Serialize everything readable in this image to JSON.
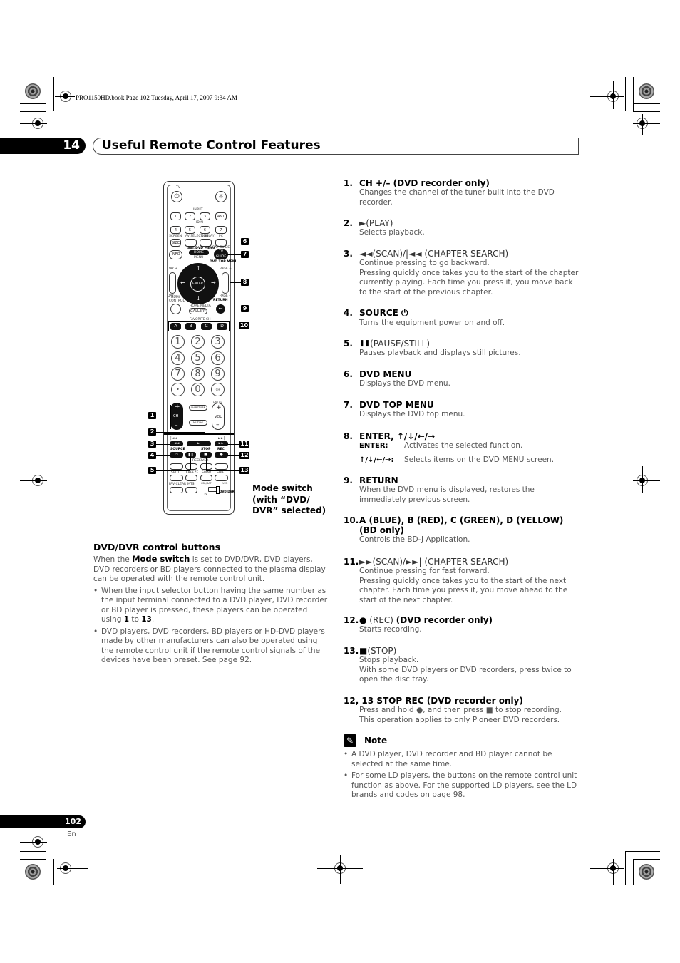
{
  "print_header": "PRO1150HD.book  Page 102  Tuesday, April 17, 2007  9:34 AM",
  "chapter": {
    "number": "14",
    "title": "Useful Remote Control Features"
  },
  "remote": {
    "tv_label": "TV",
    "input_label": "INPUT",
    "hdmi_label": "HDMI",
    "input_buttons": [
      "1",
      "2",
      "3",
      "ANT"
    ],
    "hdmi_buttons": [
      "4",
      "5",
      "6",
      "7"
    ],
    "screen_size": "SIZE",
    "screen_label": "SCREEN",
    "av_selection": "AV SELECTION",
    "display": "DISPLAY",
    "pc": "PC",
    "info": "INFO",
    "sat_dvd_menu": "SAT/DVD MENU",
    "home_menu": "HOME MENU",
    "menu": "MENU",
    "sat_guide": "SAT GUIDE",
    "tv_guide": "TV GUIDE",
    "dvd_top_menu": "DVD TOP MENU",
    "enter": "ENTER",
    "day_plus": "DAY +",
    "day_minus": "DAY –",
    "page_plus": "PAGE +",
    "page_minus": "PAGE –",
    "hdmi_control": "HDMI CONTROL",
    "home_media": "HOME MEDIA",
    "gallery": "GALLERY",
    "return": "RETURN",
    "favorite_ch": "FAVORITE CH",
    "favorites": [
      "A",
      "B",
      "C",
      "D"
    ],
    "digits": [
      "1",
      "2",
      "3",
      "4",
      "5",
      "6",
      "7",
      "8",
      "9",
      "•",
      "0",
      "CH ENTER"
    ],
    "ch": "CH",
    "ch_return": "CH RETURN",
    "muting": "MUTING",
    "vol": "VOL",
    "source": "SOURCE",
    "stop_label": "STOP",
    "rec_label": "REC",
    "row_buttons": [
      "SPLIT",
      "FREEZE",
      "SWAP",
      "SHIFT"
    ],
    "bottom_buttons": [
      "FAV CLEAR",
      "MTS"
    ],
    "receiver": "RECEIVER",
    "switch_labels": [
      "CBL/SAT",
      "VCR",
      "TV",
      "DVD/DVR"
    ]
  },
  "callouts": [
    "1",
    "2",
    "3",
    "4",
    "5",
    "6",
    "7",
    "8",
    "9",
    "10",
    "11",
    "12",
    "13"
  ],
  "mode_switch_caption": [
    "Mode switch",
    "(with “DVD/",
    "DVR” selected)"
  ],
  "left_section": {
    "heading": "DVD/DVR control buttons",
    "intro_pre": "When the ",
    "intro_bold": "Mode switch",
    "intro_post": " is set to DVD/DVR, DVD players, DVD recorders or BD players connected to the plasma display can be operated with the remote control unit.",
    "bullets": [
      {
        "pre": "When the input selector button having the same number as the input terminal connected to a DVD player, DVD recorder or BD player is pressed, these players can be operated using ",
        "b1": "1",
        "mid": " to ",
        "b2": "13",
        "post": "."
      },
      {
        "text": "DVD players, DVD recorders, BD players or HD-DVD players made by other manufacturers can also be operated using the remote control unit if the remote control signals of the devices have been preset. See page 92."
      }
    ]
  },
  "items": [
    {
      "num": "1.",
      "title": "CH +/– (DVD recorder only)",
      "desc": [
        "Changes the channel of the tuner built into the DVD recorder."
      ]
    },
    {
      "num": "2.",
      "symbol": "►",
      "label": " (PLAY)",
      "desc": [
        "Selects playback."
      ]
    },
    {
      "num": "3.",
      "symbol": "◄◄",
      "label": " (SCAN)/|◄◄ (CHAPTER SEARCH)",
      "desc": [
        "Continue pressing to go backward.",
        "Pressing quickly once takes you to the start of the chapter currently playing. Each time you press it, you move back to the start of the previous chapter."
      ]
    },
    {
      "num": "4.",
      "title": "SOURCE ⏻",
      "desc": [
        "Turns the equipment power on and off."
      ]
    },
    {
      "num": "5.",
      "symbol": "❚❚",
      "label": " (PAUSE/STILL)",
      "desc": [
        "Pauses playback and displays still pictures."
      ]
    },
    {
      "num": "6.",
      "title": "DVD MENU",
      "desc": [
        "Displays the DVD menu."
      ]
    },
    {
      "num": "7.",
      "title": "DVD TOP MENU",
      "desc": [
        "Displays the DVD top menu."
      ]
    },
    {
      "num": "8.",
      "title": "ENTER, ↑/↓/←/→",
      "sub": [
        {
          "k": "ENTER:",
          "v": "Activates the selected function."
        },
        {
          "k": "↑/↓/←/→:",
          "v": "Selects items on the DVD MENU screen."
        }
      ]
    },
    {
      "num": "9.",
      "title": "RETURN",
      "desc": [
        "When the DVD menu is displayed, restores the immediately previous screen."
      ]
    },
    {
      "num": "10.",
      "title": "A (BLUE), B (RED), C (GREEN), D (YELLOW) (BD only)",
      "desc": [
        "Controls the BD-J Application."
      ]
    },
    {
      "num": "11.",
      "symbol": "►►",
      "label": " (SCAN)/►►| (CHAPTER SEARCH)",
      "desc": [
        "Continue pressing for fast forward.",
        "Pressing quickly once takes you to the start of the next chapter. Each time you press it, you move ahead to the start of the next chapter."
      ]
    },
    {
      "num": "12.",
      "symbol": "●",
      "label": " (REC) ",
      "bold_tail": "(DVD recorder only)",
      "desc": [
        "Starts recording."
      ]
    },
    {
      "num": "13.",
      "symbol": "■",
      "label": " (STOP)",
      "desc": [
        "Stops playback.",
        "With some DVD players or DVD recorders, press twice to open the disc tray."
      ]
    },
    {
      "num": "",
      "title": "12, 13 STOP REC (DVD recorder only)",
      "desc": [
        "Press and hold ●, and then press ■ to stop recording. This operation applies to only Pioneer DVD recorders."
      ]
    }
  ],
  "note": {
    "title": "Note",
    "bullets": [
      "A DVD player, DVD recorder and BD player cannot be selected at the same time.",
      "For some LD players, the buttons on the remote control unit function as above. For the supported LD players, see the LD brands and codes on page 98."
    ]
  },
  "footer": {
    "page": "102",
    "lang": "En"
  }
}
